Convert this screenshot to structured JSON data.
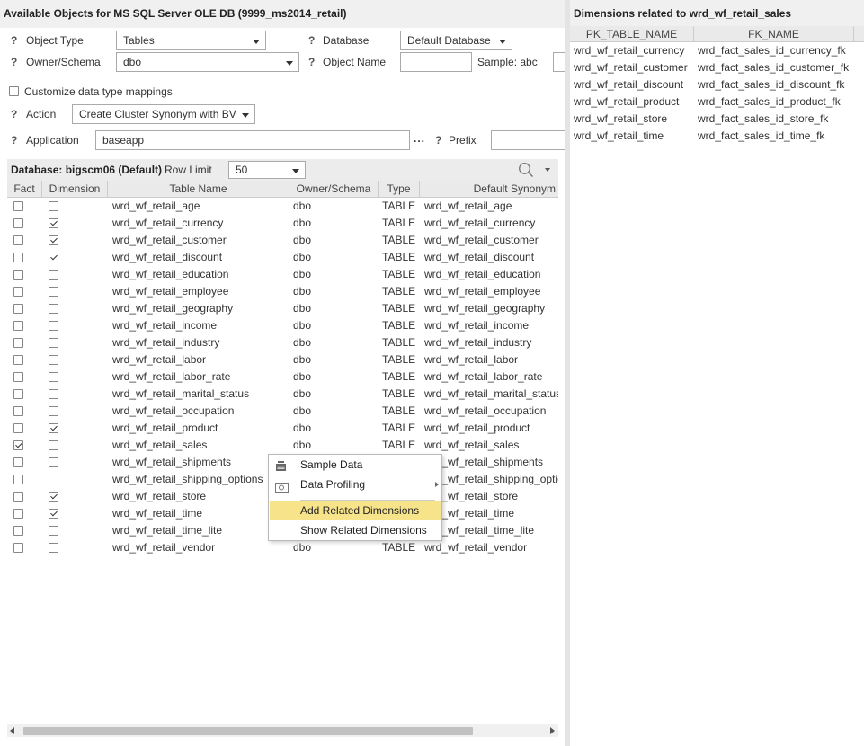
{
  "left_title": "Available Objects for MS SQL Server OLE DB (9999_ms2014_retail)",
  "help_mark": "?",
  "form": {
    "object_type_label": "Object Type",
    "object_type_value": "Tables",
    "database_label": "Database",
    "database_value": "Default Database",
    "owner_label": "Owner/Schema",
    "owner_value": "dbo",
    "object_name_label": "Object Name",
    "object_name_value": "",
    "sample_label": "Sample: abc",
    "customize_label": "Customize data type mappings",
    "action_label": "Action",
    "action_value": "Create Cluster Synonym with BV",
    "application_label": "Application",
    "application_value": "baseapp",
    "ellipsis": "...",
    "prefix_label": "Prefix",
    "prefix_value": ""
  },
  "db_bar": {
    "database_text": "Database: bigscm06 (Default)",
    "row_limit_label": "Row Limit",
    "row_limit_value": "50"
  },
  "columns": [
    "Fact",
    "Dimension",
    "Table Name",
    "Owner/Schema",
    "Type",
    "Default Synonym"
  ],
  "rows": [
    {
      "fact": false,
      "dim": false,
      "name": "wrd_wf_retail_age",
      "owner": "dbo",
      "type": "TABLE",
      "syn": "wrd_wf_retail_age"
    },
    {
      "fact": false,
      "dim": true,
      "name": "wrd_wf_retail_currency",
      "owner": "dbo",
      "type": "TABLE",
      "syn": "wrd_wf_retail_currency"
    },
    {
      "fact": false,
      "dim": true,
      "name": "wrd_wf_retail_customer",
      "owner": "dbo",
      "type": "TABLE",
      "syn": "wrd_wf_retail_customer"
    },
    {
      "fact": false,
      "dim": true,
      "name": "wrd_wf_retail_discount",
      "owner": "dbo",
      "type": "TABLE",
      "syn": "wrd_wf_retail_discount"
    },
    {
      "fact": false,
      "dim": false,
      "name": "wrd_wf_retail_education",
      "owner": "dbo",
      "type": "TABLE",
      "syn": "wrd_wf_retail_education"
    },
    {
      "fact": false,
      "dim": false,
      "name": "wrd_wf_retail_employee",
      "owner": "dbo",
      "type": "TABLE",
      "syn": "wrd_wf_retail_employee"
    },
    {
      "fact": false,
      "dim": false,
      "name": "wrd_wf_retail_geography",
      "owner": "dbo",
      "type": "TABLE",
      "syn": "wrd_wf_retail_geography"
    },
    {
      "fact": false,
      "dim": false,
      "name": "wrd_wf_retail_income",
      "owner": "dbo",
      "type": "TABLE",
      "syn": "wrd_wf_retail_income"
    },
    {
      "fact": false,
      "dim": false,
      "name": "wrd_wf_retail_industry",
      "owner": "dbo",
      "type": "TABLE",
      "syn": "wrd_wf_retail_industry"
    },
    {
      "fact": false,
      "dim": false,
      "name": "wrd_wf_retail_labor",
      "owner": "dbo",
      "type": "TABLE",
      "syn": "wrd_wf_retail_labor"
    },
    {
      "fact": false,
      "dim": false,
      "name": "wrd_wf_retail_labor_rate",
      "owner": "dbo",
      "type": "TABLE",
      "syn": "wrd_wf_retail_labor_rate"
    },
    {
      "fact": false,
      "dim": false,
      "name": "wrd_wf_retail_marital_status",
      "owner": "dbo",
      "type": "TABLE",
      "syn": "wrd_wf_retail_marital_status"
    },
    {
      "fact": false,
      "dim": false,
      "name": "wrd_wf_retail_occupation",
      "owner": "dbo",
      "type": "TABLE",
      "syn": "wrd_wf_retail_occupation"
    },
    {
      "fact": false,
      "dim": true,
      "name": "wrd_wf_retail_product",
      "owner": "dbo",
      "type": "TABLE",
      "syn": "wrd_wf_retail_product"
    },
    {
      "fact": true,
      "dim": false,
      "name": "wrd_wf_retail_sales",
      "owner": "dbo",
      "type": "TABLE",
      "syn": "wrd_wf_retail_sales"
    },
    {
      "fact": false,
      "dim": false,
      "name": "wrd_wf_retail_shipments",
      "owner": "",
      "type": "",
      "syn": "wrd_wf_retail_shipments"
    },
    {
      "fact": false,
      "dim": false,
      "name": "wrd_wf_retail_shipping_options",
      "owner": "",
      "type": "",
      "syn": "wrd_wf_retail_shipping_optio"
    },
    {
      "fact": false,
      "dim": true,
      "name": "wrd_wf_retail_store",
      "owner": "",
      "type": "",
      "syn": "wrd_wf_retail_store"
    },
    {
      "fact": false,
      "dim": true,
      "name": "wrd_wf_retail_time",
      "owner": "",
      "type": "",
      "syn": "wrd_wf_retail_time"
    },
    {
      "fact": false,
      "dim": false,
      "name": "wrd_wf_retail_time_lite",
      "owner": "",
      "type": "",
      "syn": "wrd_wf_retail_time_lite"
    },
    {
      "fact": false,
      "dim": false,
      "name": "wrd_wf_retail_vendor",
      "owner": "dbo",
      "type": "TABLE",
      "syn": "wrd_wf_retail_vendor"
    }
  ],
  "context_menu": {
    "sample_data": "Sample Data",
    "data_profiling": "Data Profiling",
    "add_related": "Add Related Dimensions",
    "show_related": "Show Related Dimensions"
  },
  "right_title": "Dimensions related to wrd_wf_retail_sales",
  "right_columns": [
    "PK_TABLE_NAME",
    "FK_NAME"
  ],
  "right_rows": [
    {
      "pk": "wrd_wf_retail_currency",
      "fk": "wrd_fact_sales_id_currency_fk"
    },
    {
      "pk": "wrd_wf_retail_customer",
      "fk": "wrd_fact_sales_id_customer_fk"
    },
    {
      "pk": "wrd_wf_retail_discount",
      "fk": "wrd_fact_sales_id_discount_fk"
    },
    {
      "pk": "wrd_wf_retail_product",
      "fk": "wrd_fact_sales_id_product_fk"
    },
    {
      "pk": "wrd_wf_retail_store",
      "fk": "wrd_fact_sales_id_store_fk"
    },
    {
      "pk": "wrd_wf_retail_time",
      "fk": "wrd_fact_sales_id_time_fk"
    }
  ],
  "colors": {
    "menu_highlight": "#f7e38a",
    "header_bg": "#eaeaea",
    "title_bg": "#f0f0f0"
  }
}
